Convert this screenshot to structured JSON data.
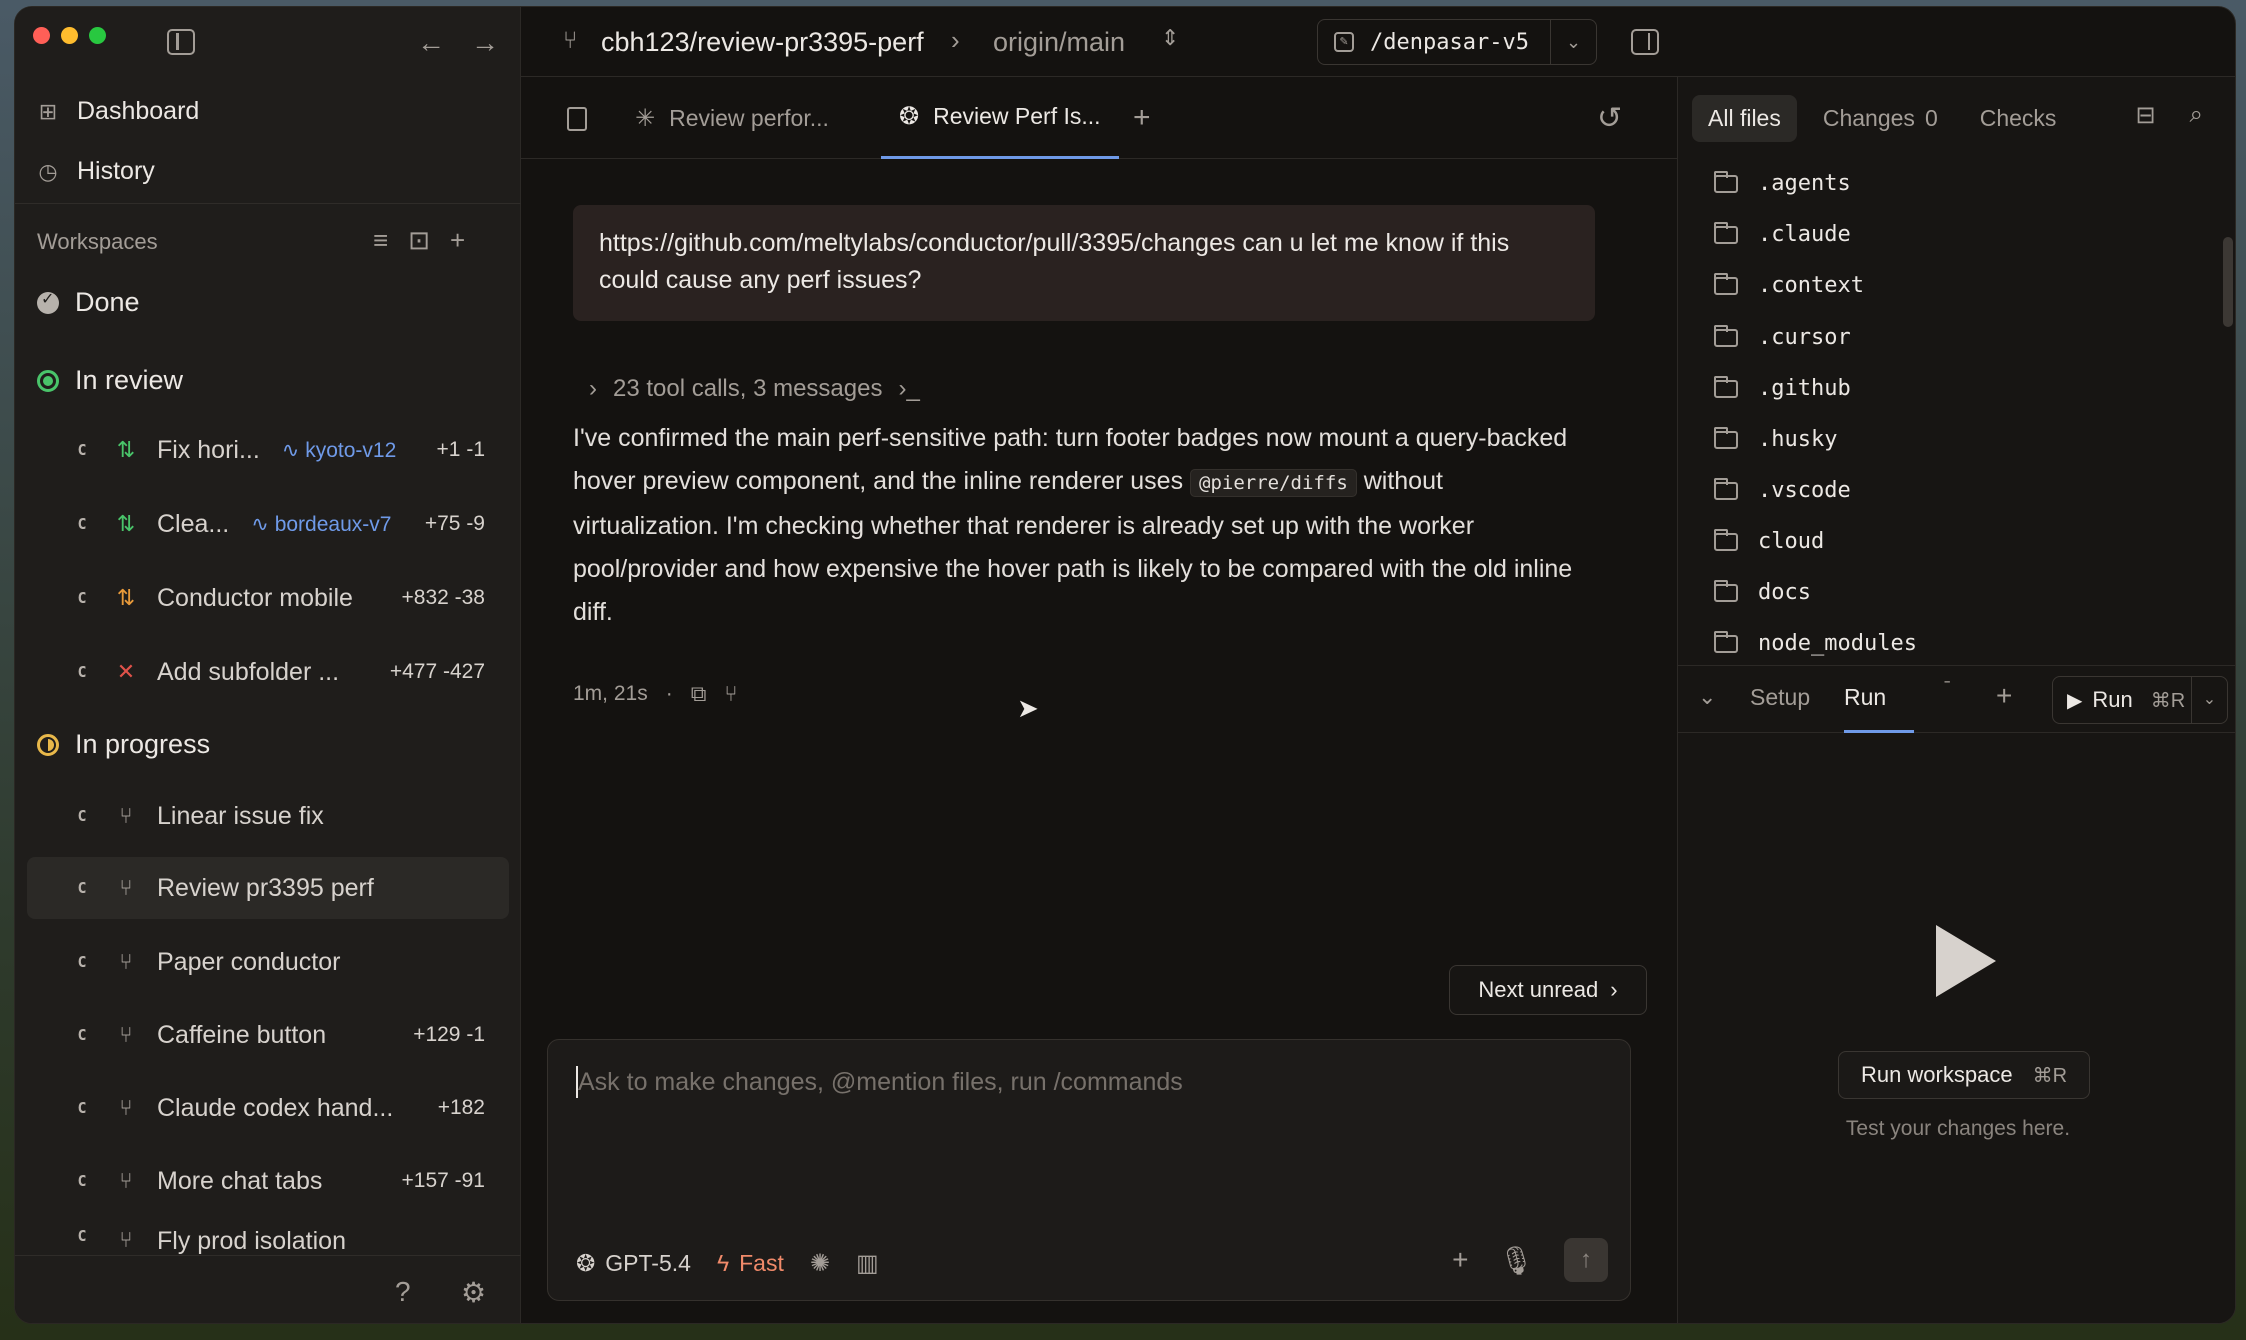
{
  "window": {
    "back_icon": "←",
    "forward_icon": "→"
  },
  "sidebar": {
    "nav": [
      {
        "label": "Dashboard",
        "icon": "grid-icon"
      },
      {
        "label": "History",
        "icon": "clock-icon"
      }
    ],
    "workspaces_label": "Workspaces",
    "groups": {
      "done": {
        "label": "Done"
      },
      "in_review": {
        "label": "In review",
        "items": [
          {
            "badge": "C",
            "name": "Fix hori...",
            "branch": "kyoto-v12",
            "diff": "+1 -1"
          },
          {
            "badge": "C",
            "name": "Clea...",
            "branch": "bordeaux-v7",
            "diff": "+75 -9"
          },
          {
            "badge": "C",
            "name": "Conductor mobile",
            "branch": "",
            "diff": "+832 -38"
          },
          {
            "badge": "C",
            "name": "Add subfolder ...",
            "branch": "",
            "diff": "+477 -427"
          }
        ]
      },
      "in_progress": {
        "label": "In progress",
        "items": [
          {
            "badge": "C",
            "name": "Linear issue fix",
            "diff": ""
          },
          {
            "badge": "C",
            "name": "Review pr3395 perf",
            "diff": ""
          },
          {
            "badge": "C",
            "name": "Paper conductor",
            "diff": ""
          },
          {
            "badge": "C",
            "name": "Caffeine button",
            "diff": "+129 -1"
          },
          {
            "badge": "C",
            "name": "Claude codex hand...",
            "diff": "+182"
          },
          {
            "badge": "C",
            "name": "More chat tabs",
            "diff": "+157 -91"
          },
          {
            "badge": "C",
            "name": "Fly prod isolation",
            "diff": ""
          }
        ]
      }
    }
  },
  "topbar": {
    "branch": "cbh123/review-pr3395-perf",
    "target": "origin/main",
    "path": "/denpasar-v5"
  },
  "chat": {
    "tabs": [
      {
        "label": "Review perfor..."
      },
      {
        "label": "Review Perf Is..."
      }
    ],
    "user_message": "https://github.com/meltylabs/conductor/pull/3395/changes can u let me know if this could cause any perf issues?",
    "tool_summary": "23 tool calls, 3 messages",
    "assistant_before_code": "I've confirmed the main perf-sensitive path: turn footer badges now mount a query-backed hover preview component, and the inline renderer uses",
    "assistant_code": "@pierre/diffs",
    "assistant_after_code": "without virtualization. I'm checking whether that renderer is already set up with the worker pool/provider and how expensive the hover path is likely to be compared with the old inline diff.",
    "duration": "1m, 21s",
    "next_unread": "Next unread",
    "composer_placeholder": "Ask to make changes, @mention files, run /commands",
    "model": "GPT-5.4",
    "speed": "Fast"
  },
  "right_panel": {
    "tabs": [
      {
        "label": "All files"
      },
      {
        "label": "Changes",
        "count": "0"
      },
      {
        "label": "Checks"
      }
    ],
    "files": [
      ".agents",
      ".claude",
      ".context",
      ".cursor",
      ".github",
      ".husky",
      ".vscode",
      "cloud",
      "docs",
      "node_modules"
    ],
    "run_tabs": {
      "setup": "Setup",
      "run": "Run"
    },
    "run_button": {
      "label": "Run",
      "shortcut": "⌘R"
    },
    "run_workspace": {
      "label": "Run workspace",
      "shortcut": "⌘R"
    },
    "hint": "Test your changes here."
  }
}
